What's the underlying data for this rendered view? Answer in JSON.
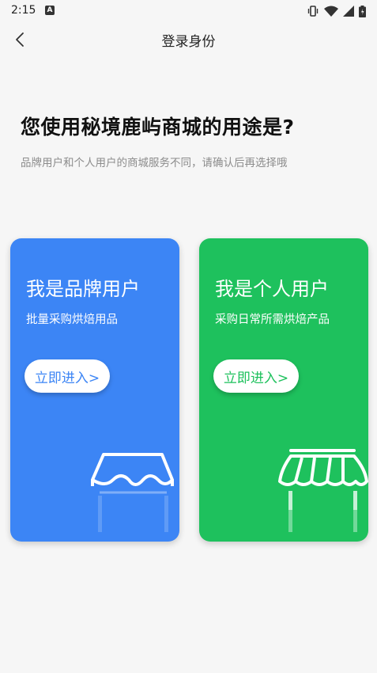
{
  "status_bar": {
    "time": "2:15",
    "notification_glyph": "A",
    "icons": [
      "vibrate-icon",
      "wifi-icon",
      "signal-icon",
      "battery-icon"
    ]
  },
  "header": {
    "title": "登录身份",
    "back_icon": "chevron-left-icon"
  },
  "main": {
    "question": "您使用秘境鹿屿商城的用途是?",
    "subtitle": "品牌用户和个人用户的商城服务不同，请确认后再选择哦"
  },
  "cards": [
    {
      "title": "我是品牌用户",
      "description": "批量采购烘焙用品",
      "button_label": "立即进入>",
      "color": "#3c85f5",
      "icon": "storefront-awning-icon"
    },
    {
      "title": "我是个人用户",
      "description": "采购日常所需烘焙产品",
      "button_label": "立即进入>",
      "color": "#1ec15d",
      "icon": "striped-awning-icon"
    }
  ]
}
